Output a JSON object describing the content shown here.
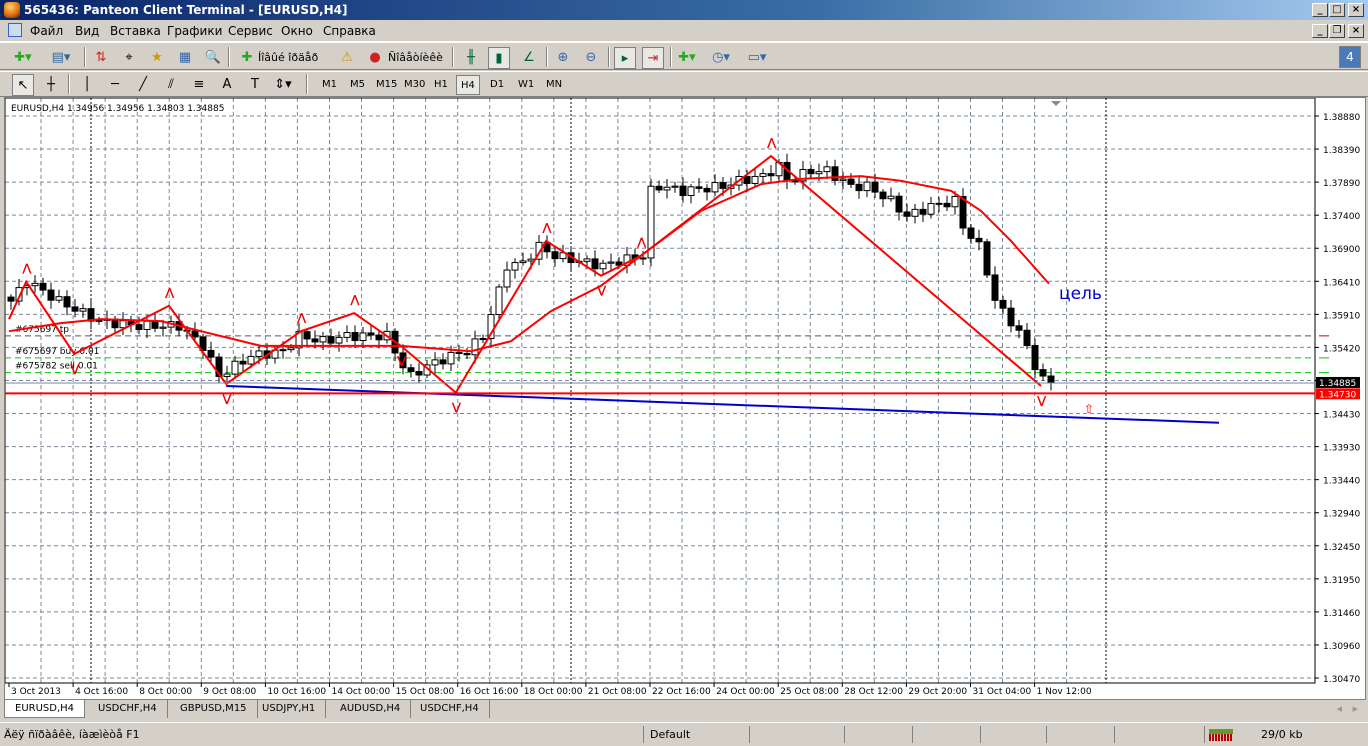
{
  "window": {
    "title": "565436: Panteon Client Terminal - [EURUSD,H4]"
  },
  "menu": [
    "Файл",
    "Вид",
    "Вставка",
    "Графики",
    "Сервис",
    "Окно",
    "Справка"
  ],
  "toolbar": {
    "new_order": "Íîâûé îðäåð",
    "experts": "Ñîâåòíèêè"
  },
  "timeframes": [
    "M1",
    "M5",
    "M15",
    "M30",
    "H1",
    "H4",
    "D1",
    "W1",
    "MN"
  ],
  "active_timeframe": "H4",
  "notification_count": "4",
  "chart_header": "EURUSD,H4  1.34956 1.34956 1.34803 1.34885",
  "tabs": [
    "EURUSD,H4",
    "USDCHF,H4",
    "GBPUSD,M15",
    "USDJPY,H1",
    "AUDUSD,H4",
    "USDCHF,H4"
  ],
  "status": {
    "help": "Äëÿ ñïðàâêè, íàæìèòå F1",
    "profile": "Default",
    "traffic": "29/0 kb"
  },
  "colors": {
    "up": "#ffffff",
    "down": "#000000",
    "indicator": "#ff0000",
    "trend": "#0000cc",
    "order": "#00cc00"
  },
  "chart_data": {
    "type": "candlestick",
    "symbol": "EURUSD",
    "timeframe": "H4",
    "ylim": [
      1.3047,
      1.3888
    ],
    "price_ticks": [
      "1.38880",
      "1.38390",
      "1.37890",
      "1.37400",
      "1.36900",
      "1.36410",
      "1.35910",
      "1.35420",
      "1.34930",
      "1.34430",
      "1.33930",
      "1.33440",
      "1.32940",
      "1.32450",
      "1.31950",
      "1.31460",
      "1.30960",
      "1.30470"
    ],
    "time_ticks": [
      "3 Oct 2013",
      "4 Oct 16:00",
      "8 Oct 00:00",
      "9 Oct 08:00",
      "10 Oct 16:00",
      "14 Oct 00:00",
      "15 Oct 08:00",
      "16 Oct 16:00",
      "18 Oct 00:00",
      "21 Oct 08:00",
      "22 Oct 16:00",
      "24 Oct 00:00",
      "25 Oct 08:00",
      "28 Oct 12:00",
      "29 Oct 20:00",
      "31 Oct 04:00",
      "1 Nov 12:00"
    ],
    "bars_per_time_tick": 8,
    "close_keypoints": [
      [
        0,
        1.3611
      ],
      [
        2,
        1.3641
      ],
      [
        6,
        1.3611
      ],
      [
        11,
        1.3581
      ],
      [
        16,
        1.3574
      ],
      [
        21,
        1.3574
      ],
      [
        24,
        1.3544
      ],
      [
        26,
        1.3499
      ],
      [
        28,
        1.3514
      ],
      [
        30,
        1.3529
      ],
      [
        34,
        1.3536
      ],
      [
        36,
        1.3559
      ],
      [
        39,
        1.3551
      ],
      [
        42,
        1.3559
      ],
      [
        47,
        1.3559
      ],
      [
        49,
        1.3514
      ],
      [
        50,
        1.3499
      ],
      [
        52,
        1.3514
      ],
      [
        55,
        1.3529
      ],
      [
        57,
        1.3536
      ],
      [
        59,
        1.3559
      ],
      [
        61,
        1.3626
      ],
      [
        62,
        1.3664
      ],
      [
        64,
        1.3668
      ],
      [
        66,
        1.3693
      ],
      [
        68,
        1.3679
      ],
      [
        71,
        1.3671
      ],
      [
        74,
        1.3664
      ],
      [
        76,
        1.3671
      ],
      [
        79,
        1.3679
      ],
      [
        80,
        1.3776
      ],
      [
        81,
        1.3783
      ],
      [
        84,
        1.3776
      ],
      [
        89,
        1.3783
      ],
      [
        91,
        1.3791
      ],
      [
        94,
        1.3798
      ],
      [
        96,
        1.3813
      ],
      [
        97,
        1.3791
      ],
      [
        100,
        1.3806
      ],
      [
        102,
        1.3806
      ],
      [
        105,
        1.3783
      ],
      [
        107,
        1.3783
      ],
      [
        110,
        1.3761
      ],
      [
        112,
        1.3738
      ],
      [
        115,
        1.3753
      ],
      [
        118,
        1.3761
      ],
      [
        119,
        1.3723
      ],
      [
        121,
        1.3693
      ],
      [
        122,
        1.3656
      ],
      [
        123,
        1.3611
      ],
      [
        125,
        1.3581
      ],
      [
        127,
        1.3544
      ],
      [
        128,
        1.3514
      ],
      [
        129,
        1.3492
      ],
      [
        130,
        1.3488
      ]
    ],
    "zigzag": [
      [
        -0.25,
        1.3584
      ],
      [
        1.9,
        1.364
      ],
      [
        7.9,
        1.3532
      ],
      [
        19.75,
        1.3604
      ],
      [
        26.9,
        1.3487
      ],
      [
        36.25,
        1.3566
      ],
      [
        42.9,
        1.3593
      ],
      [
        48.75,
        1.3544
      ],
      [
        55.6,
        1.3474
      ],
      [
        66.9,
        1.3701
      ],
      [
        73.75,
        1.3649
      ],
      [
        78.75,
        1.3679
      ],
      [
        95,
        1.3828
      ],
      [
        128.75,
        1.3484
      ]
    ],
    "moving_average": [
      [
        -0.25,
        1.3566
      ],
      [
        6.25,
        1.3578
      ],
      [
        11.25,
        1.3584
      ],
      [
        18.75,
        1.3581
      ],
      [
        23.75,
        1.3566
      ],
      [
        31.25,
        1.3544
      ],
      [
        48.75,
        1.3544
      ],
      [
        57.5,
        1.3536
      ],
      [
        62.5,
        1.3551
      ],
      [
        67.5,
        1.3596
      ],
      [
        73.75,
        1.3634
      ],
      [
        78.75,
        1.3679
      ],
      [
        86.25,
        1.3746
      ],
      [
        93.75,
        1.3786
      ],
      [
        98.75,
        1.3794
      ],
      [
        106.25,
        1.3798
      ],
      [
        111.25,
        1.3791
      ],
      [
        117.5,
        1.3776
      ],
      [
        121.25,
        1.3746
      ],
      [
        125,
        1.3701
      ],
      [
        129.75,
        1.3637
      ]
    ],
    "trendline": [
      [
        26.9,
        1.3484
      ],
      [
        151,
        1.3429
      ]
    ],
    "bid": "1.34885",
    "bid_value": 1.34885,
    "level": "1.34730",
    "level_value": 1.3473,
    "orders": [
      {
        "label": "#675697 tp",
        "price": 1.3559,
        "color": "#cc0000"
      },
      {
        "label": "#675697 buy 0.01",
        "price": 1.3526,
        "color": "#00cc00"
      },
      {
        "label": "#675782 sell 0.01",
        "price": 1.3504,
        "color": "#00cc00"
      }
    ],
    "annotation": "цель"
  }
}
